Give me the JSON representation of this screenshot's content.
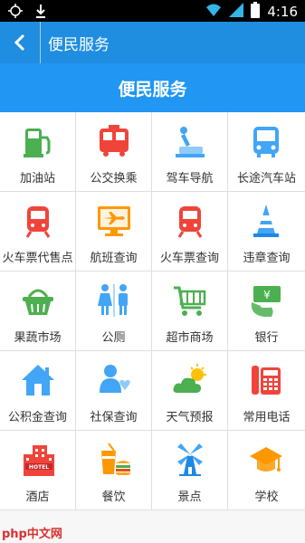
{
  "status_bar": {
    "time": "4:16"
  },
  "title_bar": {
    "title": "便民服务"
  },
  "banner": {
    "title": "便民服务"
  },
  "services": [
    {
      "label": "加油站",
      "icon": "gas-station-icon"
    },
    {
      "label": "公交换乘",
      "icon": "bus-icon"
    },
    {
      "label": "驾车导航",
      "icon": "navigation-icon"
    },
    {
      "label": "长途汽车站",
      "icon": "coach-icon"
    },
    {
      "label": "火车票代售点",
      "icon": "train-ticket-agent-icon"
    },
    {
      "label": "航班查询",
      "icon": "flight-icon"
    },
    {
      "label": "火车票查询",
      "icon": "train-icon"
    },
    {
      "label": "违章查询",
      "icon": "traffic-cone-icon"
    },
    {
      "label": "果蔬市场",
      "icon": "basket-icon"
    },
    {
      "label": "公厕",
      "icon": "toilet-icon"
    },
    {
      "label": "超市商场",
      "icon": "shopping-cart-icon"
    },
    {
      "label": "银行",
      "icon": "bank-icon"
    },
    {
      "label": "公积金查询",
      "icon": "house-icon"
    },
    {
      "label": "社保查询",
      "icon": "social-security-icon"
    },
    {
      "label": "天气预报",
      "icon": "weather-icon"
    },
    {
      "label": "常用电话",
      "icon": "telephone-icon"
    },
    {
      "label": "酒店",
      "icon": "hotel-icon"
    },
    {
      "label": "餐饮",
      "icon": "restaurant-icon"
    },
    {
      "label": "景点",
      "icon": "windmill-icon"
    },
    {
      "label": "学校",
      "icon": "graduation-cap-icon"
    }
  ],
  "watermark": {
    "text": "php中文网"
  },
  "colors": {
    "title_bar": "#1f8de0",
    "banner": "#2196f3",
    "green": "#4caf50",
    "red": "#f0443a",
    "blue": "#42a5f5",
    "orange": "#ff9800"
  }
}
